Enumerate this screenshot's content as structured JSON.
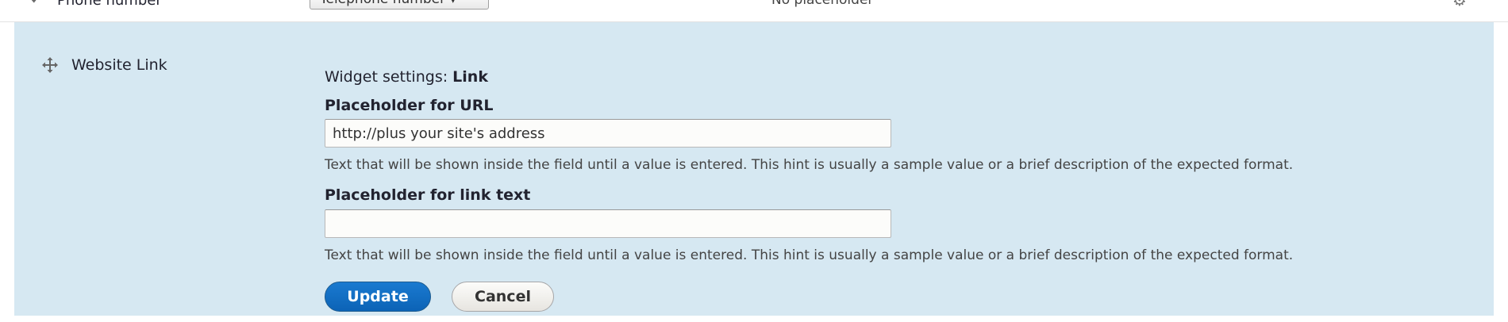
{
  "top_row": {
    "field_label": "Phone number",
    "widget_select": "Telephone number",
    "summary": "No placeholder"
  },
  "edit_row": {
    "field_label": "Website Link",
    "widget_settings_prefix": "Widget settings:",
    "widget_settings_name": "Link",
    "url_placeholder": {
      "label": "Placeholder for URL",
      "value": "http://plus your site's address",
      "description": "Text that will be shown inside the field until a value is entered. This hint is usually a sample value or a brief description of the expected format."
    },
    "link_text_placeholder": {
      "label": "Placeholder for link text",
      "value": "",
      "description": "Text that will be shown inside the field until a value is entered. This hint is usually a sample value or a brief description of the expected format."
    },
    "buttons": {
      "update": "Update",
      "cancel": "Cancel"
    }
  },
  "icons": {
    "drag": "move-icon",
    "settings": "gear-icon"
  },
  "colors": {
    "row_highlight": "#d6e8f2",
    "primary_button": "#0c63b6"
  }
}
